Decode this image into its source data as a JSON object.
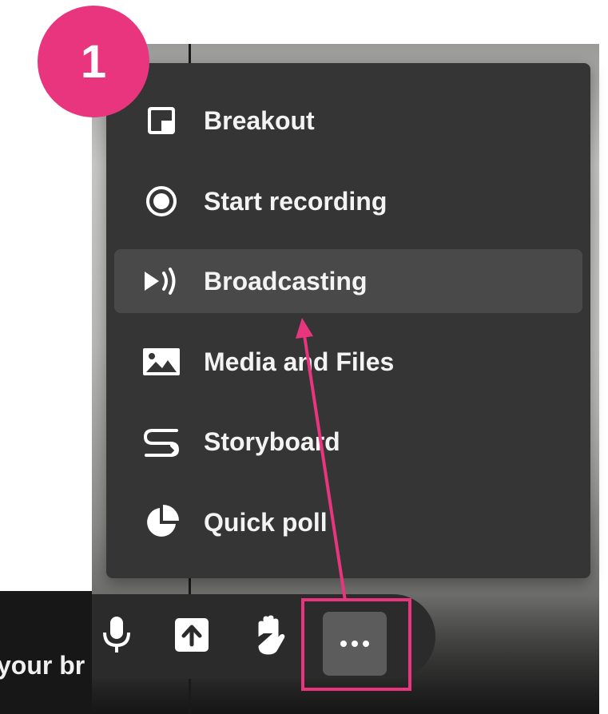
{
  "step": {
    "number": "1"
  },
  "menu": {
    "items": [
      {
        "label": "Breakout",
        "icon": "breakout-icon",
        "active": false
      },
      {
        "label": "Start recording",
        "icon": "record-icon",
        "active": false
      },
      {
        "label": "Broadcasting",
        "icon": "broadcast-icon",
        "active": true
      },
      {
        "label": "Media and Files",
        "icon": "image-icon",
        "active": false
      },
      {
        "label": "Storyboard",
        "icon": "storyboard-icon",
        "active": false
      },
      {
        "label": "Quick poll",
        "icon": "pie-chart-icon",
        "active": false
      }
    ]
  },
  "toolbar": {
    "buttons": [
      "microphone-icon",
      "share-screen-icon",
      "raise-hand-icon",
      "more-options-icon"
    ]
  },
  "tooltip": {
    "text": "your br"
  },
  "colors": {
    "accent": "#e8357d",
    "menu_bg": "#353535",
    "menu_active_bg": "#494949",
    "toolbar_bg": "#2b2b2b",
    "more_button_bg": "#5c5c5c"
  }
}
